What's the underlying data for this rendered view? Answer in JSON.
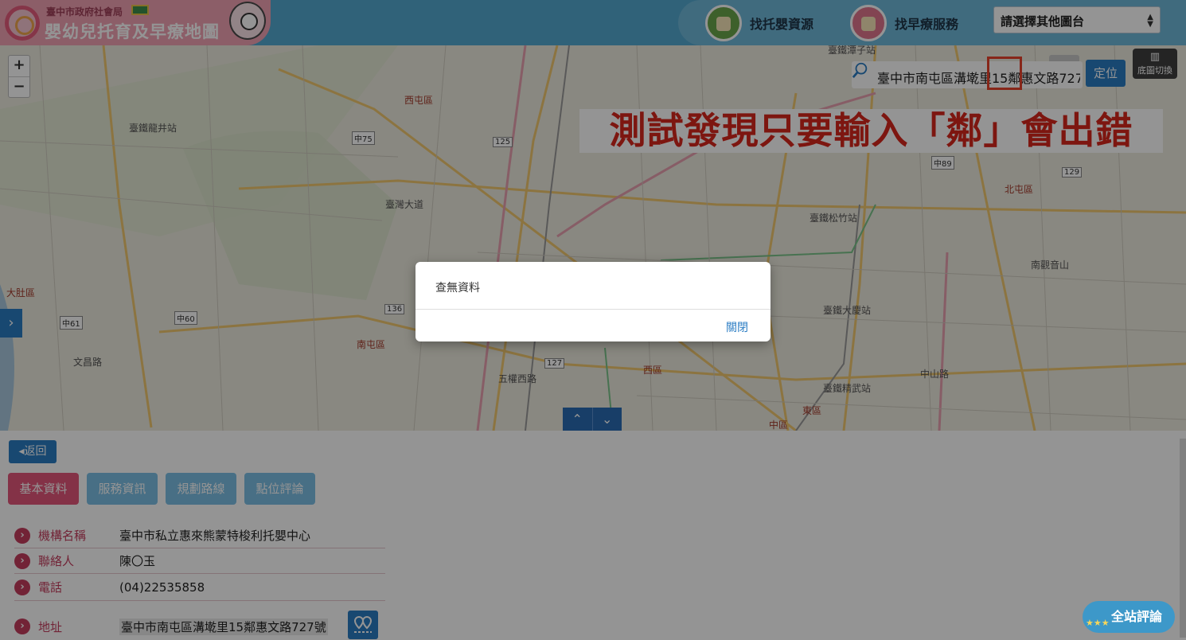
{
  "header": {
    "sub_title": "臺中市政府社會局",
    "title": "嬰幼兒托育及早療地圖",
    "nav_childcare": "找托嬰資源",
    "nav_early": "找早療服務",
    "select_value": "請選擇其他圖台",
    "select_arrows": "▲▼"
  },
  "map": {
    "zoom_in": "+",
    "zoom_out": "−",
    "search_value": "臺中市南屯區溝墘里15鄰惠文路727",
    "locate": "定位",
    "basemap": "底圖切換",
    "annotation": "測試發現只要輸入「鄰」會出錯",
    "side_toggle": "›",
    "up": "⌃",
    "down": "⌄",
    "labels": [
      {
        "text": "西屯區",
        "kind": "red"
      },
      {
        "text": "北屯區",
        "kind": "red"
      },
      {
        "text": "南屯區",
        "kind": "red"
      },
      {
        "text": "西區",
        "kind": "red"
      },
      {
        "text": "東區",
        "kind": "red"
      },
      {
        "text": "大肚區",
        "kind": "red"
      },
      {
        "text": "中區",
        "kind": "red"
      },
      {
        "text": "臺鐵龍井站",
        "kind": "plain"
      },
      {
        "text": "臺鐵松竹站",
        "kind": "plain"
      },
      {
        "text": "臺鐵大慶站",
        "kind": "plain"
      },
      {
        "text": "臺鐵精武站",
        "kind": "plain"
      },
      {
        "text": "臺鐵潭子站",
        "kind": "plain"
      },
      {
        "text": "南觀音山",
        "kind": "plain"
      },
      {
        "text": "臺灣大道",
        "kind": "plain"
      },
      {
        "text": "中山路",
        "kind": "plain"
      },
      {
        "text": "文昌路",
        "kind": "plain"
      },
      {
        "text": "五權西路",
        "kind": "plain"
      },
      {
        "text": "中75",
        "kind": "box"
      },
      {
        "text": "125",
        "kind": "box"
      },
      {
        "text": "127",
        "kind": "box"
      },
      {
        "text": "136",
        "kind": "box"
      },
      {
        "text": "中61",
        "kind": "box"
      },
      {
        "text": "中60",
        "kind": "box"
      },
      {
        "text": "中89",
        "kind": "box"
      },
      {
        "text": "129",
        "kind": "box"
      }
    ]
  },
  "panel": {
    "back": "返回",
    "tabs": [
      "基本資料",
      "服務資訊",
      "規劃路線",
      "點位評論"
    ],
    "rows": [
      {
        "label": "機構名稱",
        "value": "臺中市私立惠來熊蒙特梭利托嬰中心"
      },
      {
        "label": "聯絡人",
        "value": "陳〇玉"
      },
      {
        "label": "電話",
        "value": "(04)22535858"
      },
      {
        "label": "地址",
        "value": "臺中市南屯區溝墘里15鄰惠文路727號"
      }
    ],
    "review": "全站評論",
    "review_stars": "★★★"
  },
  "dialog": {
    "message": "查無資料",
    "close": "關閉"
  },
  "colors": {
    "header_blue": "#54a9d0",
    "logo_pink": "#f2a3b4",
    "accent_blue": "#2a7cc3",
    "tab_active": "#e4567a",
    "annotation_red": "#d8261c"
  }
}
